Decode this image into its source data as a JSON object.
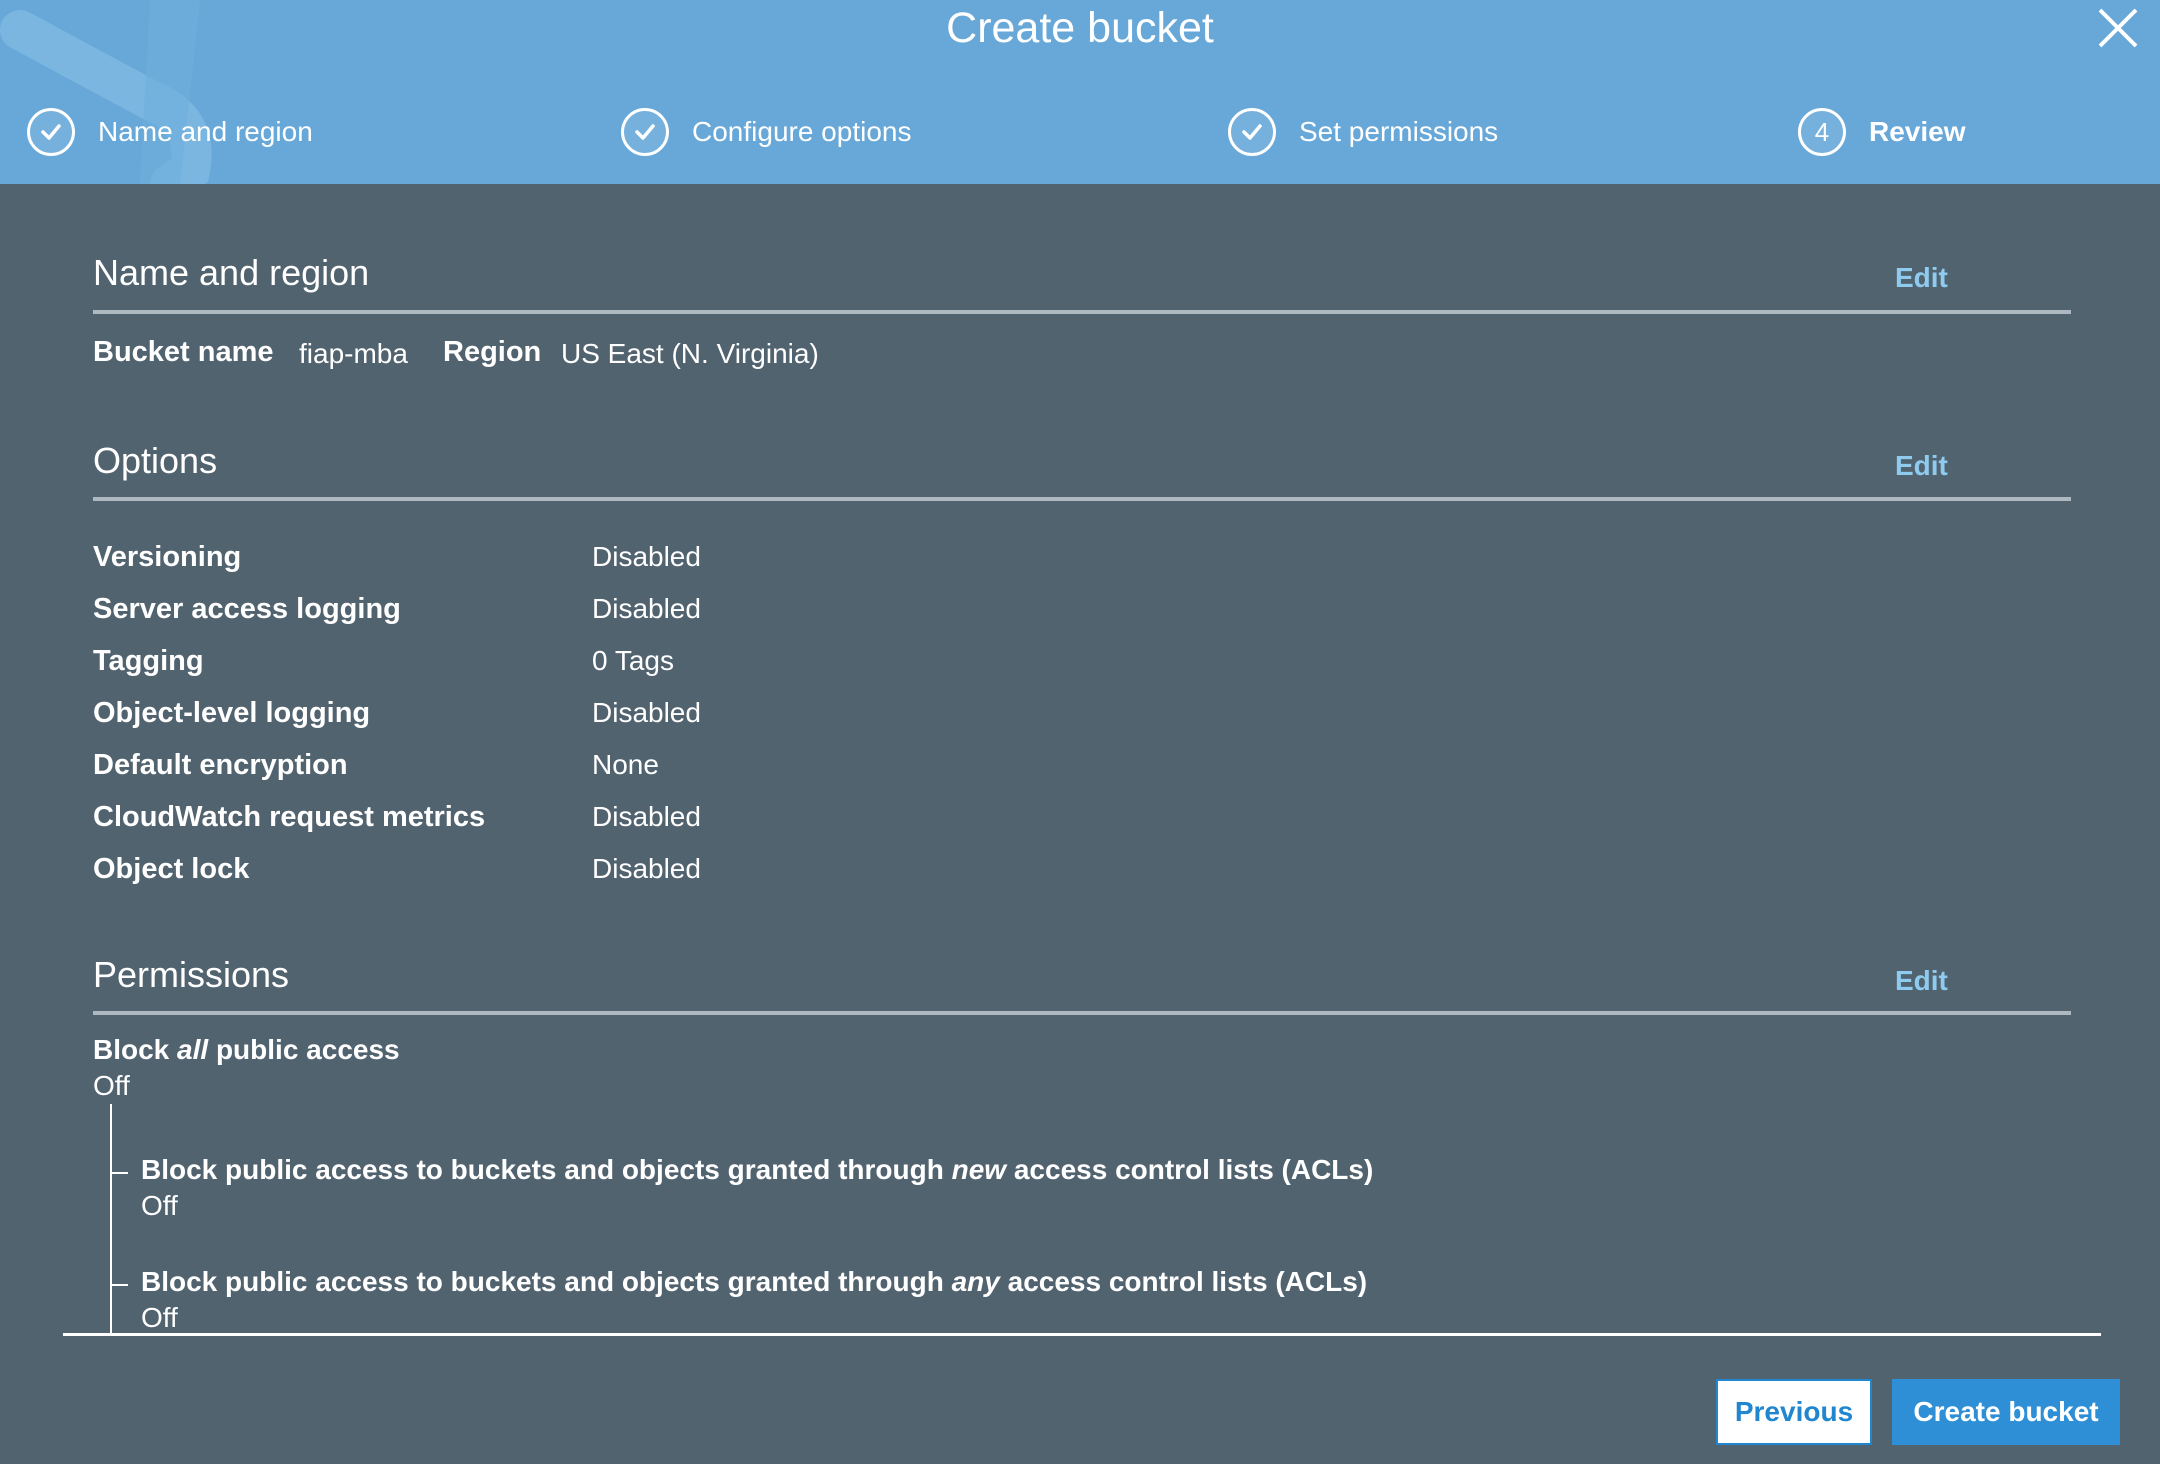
{
  "header": {
    "title": "Create bucket",
    "close_icon": "close-icon",
    "steps": [
      {
        "label": "Name and region",
        "state": "complete",
        "icon": "check-icon"
      },
      {
        "label": "Configure options",
        "state": "complete",
        "icon": "check-icon"
      },
      {
        "label": "Set permissions",
        "state": "complete",
        "icon": "check-icon"
      },
      {
        "label": "Review",
        "state": "active",
        "number": "4"
      }
    ]
  },
  "name_region": {
    "title": "Name and region",
    "edit_label": "Edit",
    "bucket_name_label": "Bucket name",
    "bucket_name_value": "fiap-mba",
    "region_label": "Region",
    "region_value": "US East (N. Virginia)"
  },
  "options": {
    "title": "Options",
    "edit_label": "Edit",
    "items": [
      {
        "label": "Versioning",
        "value": "Disabled"
      },
      {
        "label": "Server access logging",
        "value": "Disabled"
      },
      {
        "label": "Tagging",
        "value": "0 Tags"
      },
      {
        "label": "Object-level logging",
        "value": "Disabled"
      },
      {
        "label": "Default encryption",
        "value": "None"
      },
      {
        "label": "CloudWatch request metrics",
        "value": "Disabled"
      },
      {
        "label": "Object lock",
        "value": "Disabled"
      }
    ]
  },
  "permissions": {
    "title": "Permissions",
    "edit_label": "Edit",
    "block_all": {
      "prefix": "Block ",
      "emphasis": "all",
      "suffix": " public access",
      "value": "Off"
    },
    "sub_items": [
      {
        "prefix": "Block public access to buckets and objects granted through ",
        "emphasis": "new",
        "suffix": " access control lists (ACLs)",
        "value": "Off"
      },
      {
        "prefix": "Block public access to buckets and objects granted through ",
        "emphasis": "any",
        "suffix": " access control lists (ACLs)",
        "value": "Off"
      }
    ]
  },
  "footer": {
    "previous_label": "Previous",
    "create_label": "Create bucket"
  },
  "colors": {
    "header_bg": "#67a8d8",
    "body_bg": "#526370",
    "link": "#8ecbee",
    "primary_button": "#2e8fd6"
  }
}
